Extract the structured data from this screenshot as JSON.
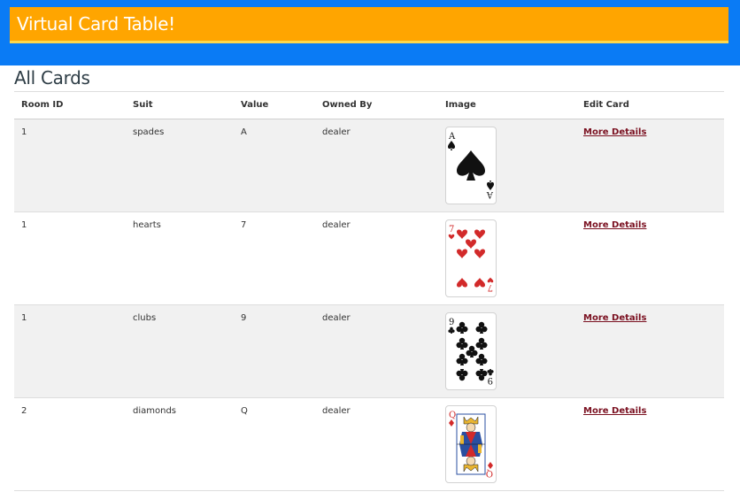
{
  "header": {
    "title": "Virtual Card Table!"
  },
  "page": {
    "title": "All Cards"
  },
  "table": {
    "columns": {
      "room_id": "Room ID",
      "suit": "Suit",
      "value": "Value",
      "owned_by": "Owned By",
      "image": "Image",
      "edit": "Edit Card"
    },
    "rows": [
      {
        "room_id": "1",
        "suit": "spades",
        "value": "A",
        "owned_by": "dealer",
        "link": "More Details"
      },
      {
        "room_id": "1",
        "suit": "hearts",
        "value": "7",
        "owned_by": "dealer",
        "link": "More Details"
      },
      {
        "room_id": "1",
        "suit": "clubs",
        "value": "9",
        "owned_by": "dealer",
        "link": "More Details"
      },
      {
        "room_id": "2",
        "suit": "diamonds",
        "value": "Q",
        "owned_by": "dealer",
        "link": "More Details"
      }
    ]
  },
  "colors": {
    "topbar": "#0a7bf5",
    "banner": "#ffa500",
    "link": "#7a1020",
    "red_suit": "#d22a2a",
    "black_suit": "#111111"
  }
}
